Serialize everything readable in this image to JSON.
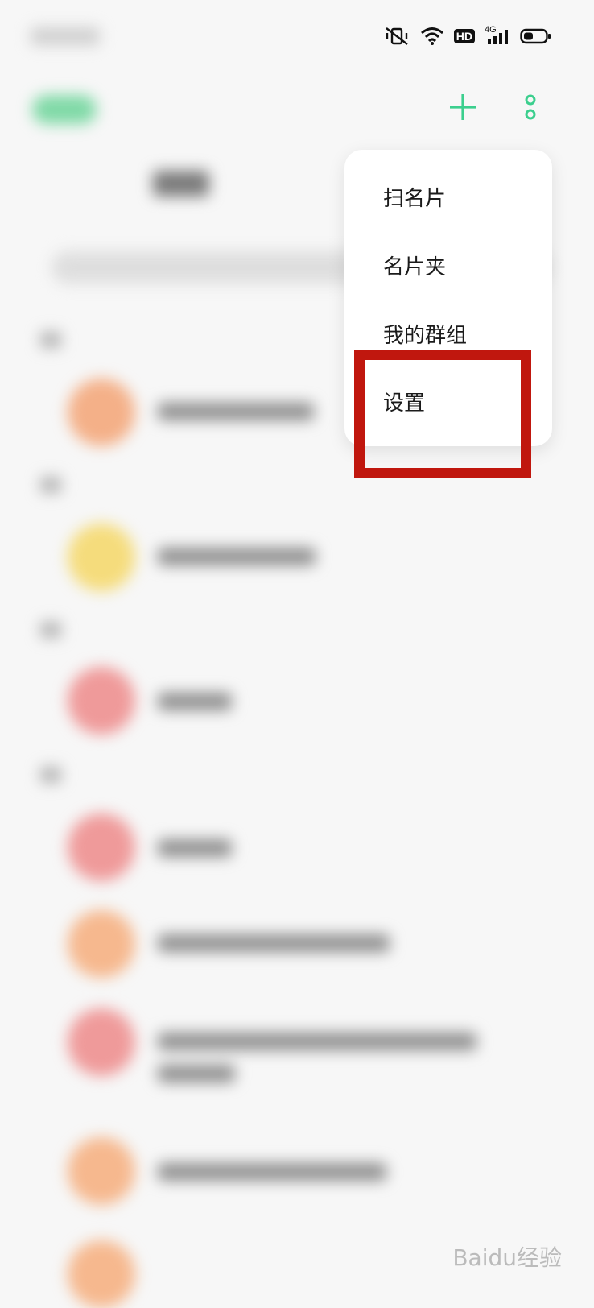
{
  "statusbar": {
    "icons": [
      "mute-vibrate-icon",
      "wifi-icon",
      "hd-badge",
      "cellular-4g-icon",
      "battery-icon"
    ],
    "hd_label": "HD",
    "network_label": "4G"
  },
  "toolbar": {
    "add_icon": "plus-icon",
    "more_icon": "more-vertical-icon",
    "accent_color": "#3ccf8e"
  },
  "menu": {
    "items": [
      {
        "label": "扫名片"
      },
      {
        "label": "名片夹"
      },
      {
        "label": "我的群组"
      },
      {
        "label": "设置"
      }
    ],
    "highlighted_item": "设置",
    "highlight_color": "#c0170e"
  },
  "background": {
    "avatar_colors": [
      "#f4b088",
      "#f5dc7c",
      "#ef9a9a",
      "#ef9a9a",
      "#f6b88e",
      "#ef9a9a",
      "#f6b88e",
      "#f6b88e"
    ]
  },
  "watermark": {
    "text": "Baidu经验"
  }
}
